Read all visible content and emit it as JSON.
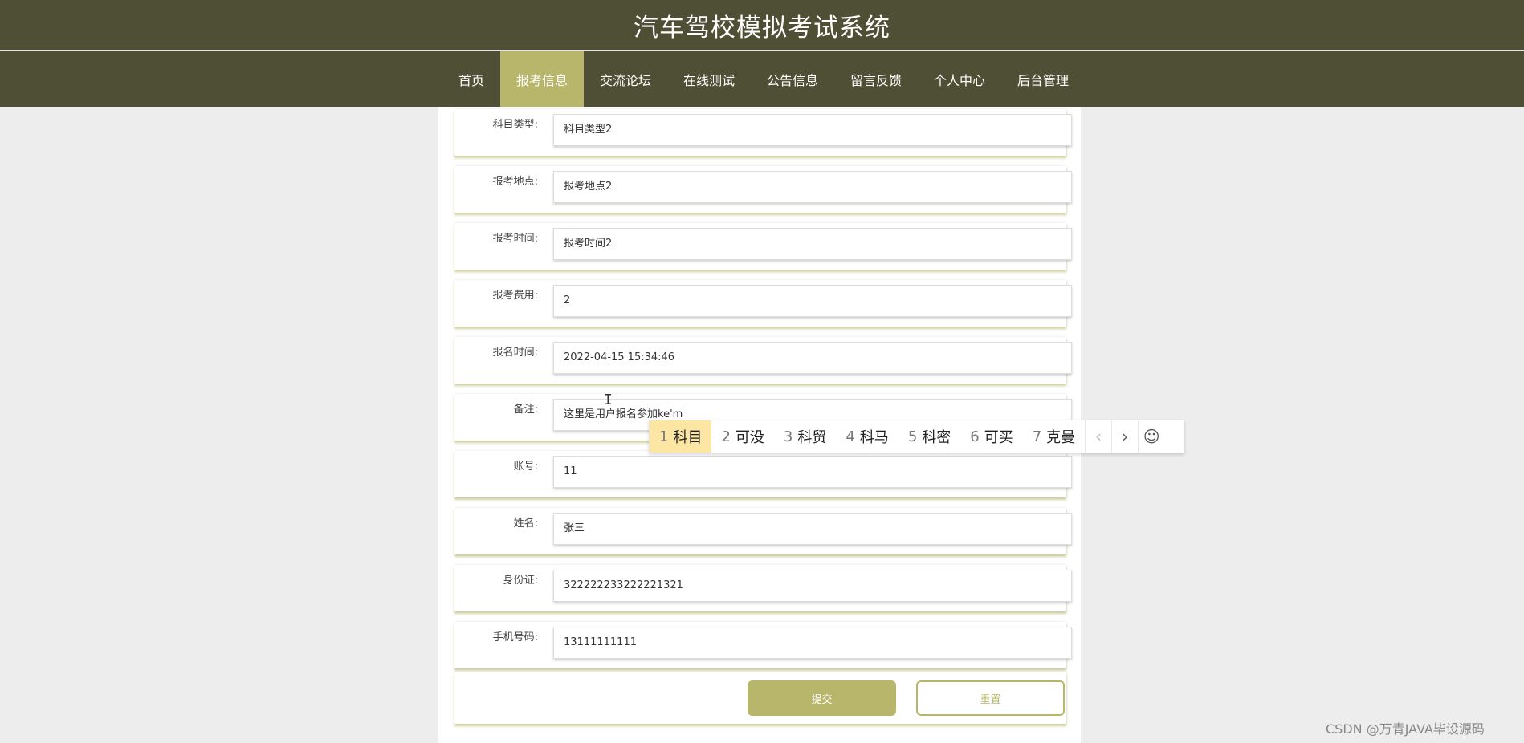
{
  "header": {
    "title": "汽车驾校模拟考试系统"
  },
  "nav": {
    "items": [
      {
        "label": "首页",
        "active": false
      },
      {
        "label": "报考信息",
        "active": true
      },
      {
        "label": "交流论坛",
        "active": false
      },
      {
        "label": "在线测试",
        "active": false
      },
      {
        "label": "公告信息",
        "active": false
      },
      {
        "label": "留言反馈",
        "active": false
      },
      {
        "label": "个人中心",
        "active": false
      },
      {
        "label": "后台管理",
        "active": false
      }
    ]
  },
  "form": {
    "fields": [
      {
        "label": "科目类型:",
        "value": "科目类型2"
      },
      {
        "label": "报考地点:",
        "value": "报考地点2"
      },
      {
        "label": "报考时间:",
        "value": "报考时间2"
      },
      {
        "label": "报考费用:",
        "value": "2"
      },
      {
        "label": "报名时间:",
        "value": "2022-04-15 15:34:46"
      },
      {
        "label": "备注:",
        "value": "这里是用户报名参加ke'm"
      },
      {
        "label": "账号:",
        "value": "11"
      },
      {
        "label": "姓名:",
        "value": "张三"
      },
      {
        "label": "身份证:",
        "value": "322222233222221321"
      },
      {
        "label": "手机号码:",
        "value": "13111111111"
      }
    ],
    "submit_label": "提交",
    "reset_label": "重置"
  },
  "ime": {
    "candidates": [
      {
        "num": "1",
        "text": "科目"
      },
      {
        "num": "2",
        "text": "可没"
      },
      {
        "num": "3",
        "text": "科贸"
      },
      {
        "num": "4",
        "text": "科马"
      },
      {
        "num": "5",
        "text": "科密"
      },
      {
        "num": "6",
        "text": "可买"
      },
      {
        "num": "7",
        "text": "克曼"
      }
    ],
    "prev_glyph": "‹",
    "next_glyph": "›",
    "emoji_glyph": "☺"
  },
  "watermark": "CSDN @万青JAVA毕设源码",
  "colors": {
    "header": "#4f4f35",
    "accent": "#b8b66b",
    "background": "#ededed"
  }
}
